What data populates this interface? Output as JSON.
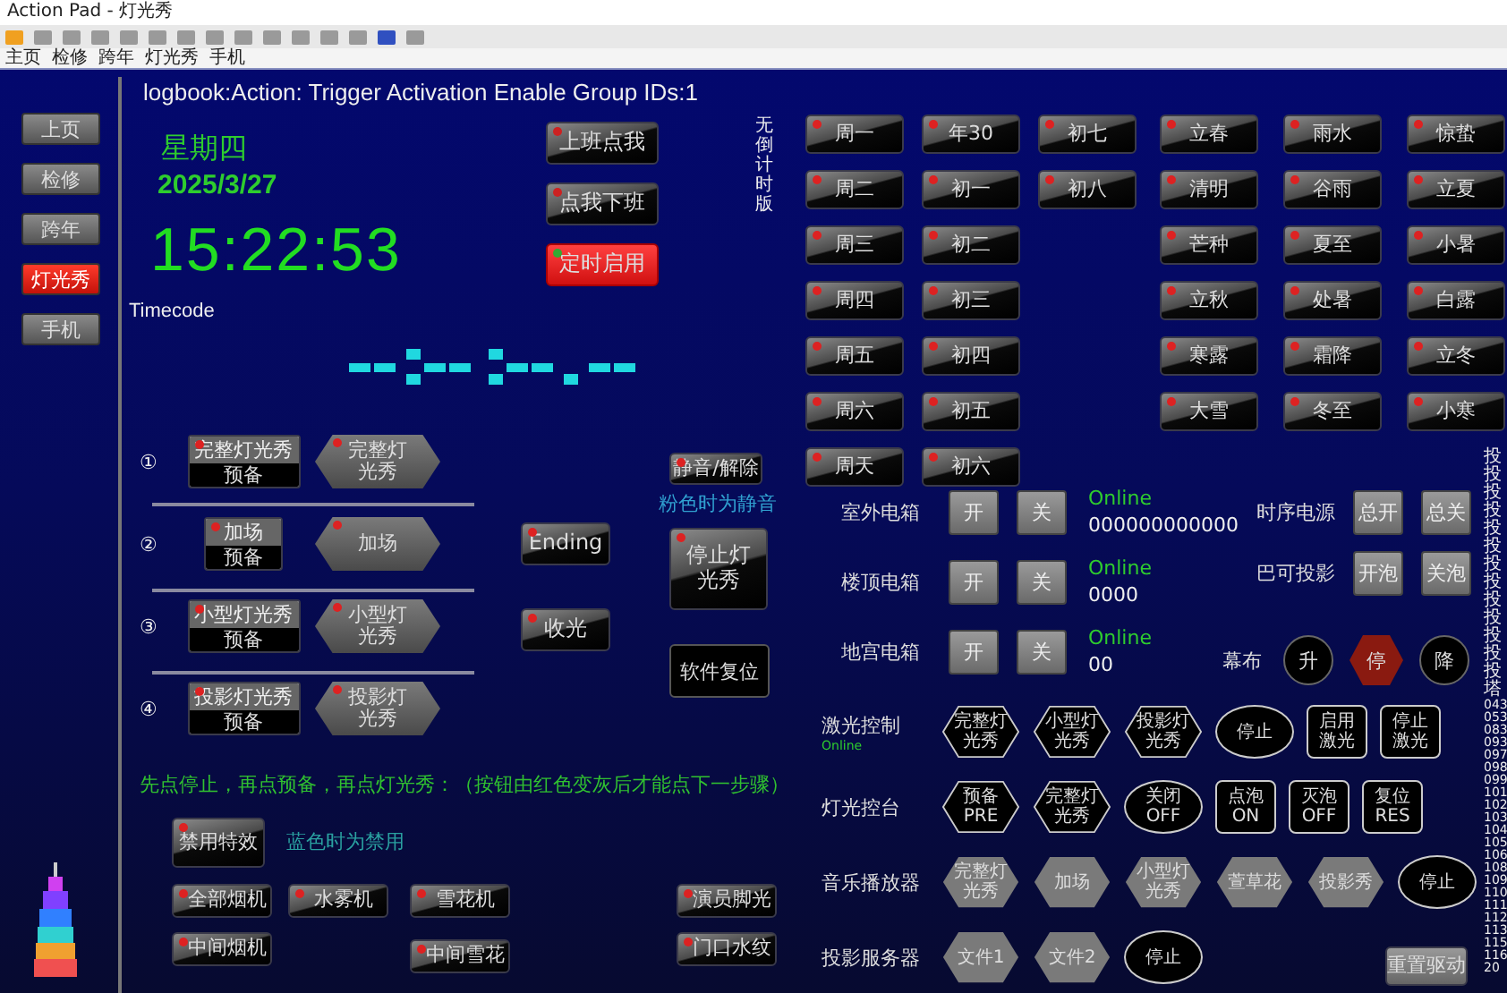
{
  "window": {
    "title": "Action Pad - 灯光秀"
  },
  "menu_tabs": [
    "主页",
    "检修",
    "跨年",
    "灯光秀",
    "手机"
  ],
  "sidebar": [
    {
      "label": "上页",
      "selected": false
    },
    {
      "label": "检修",
      "selected": false
    },
    {
      "label": "跨年",
      "selected": false
    },
    {
      "label": "灯光秀",
      "selected": true
    },
    {
      "label": "手机",
      "selected": false
    }
  ],
  "logbook": "logbook:Action: Trigger Activation Enable Group IDs:1",
  "weekday": "星期四",
  "date": "2025/3/27",
  "time": "15:22:53",
  "timecode_label": "Timecode",
  "top_buttons": [
    {
      "label": "上班点我",
      "color": "#cc2222",
      "active": false
    },
    {
      "label": "点我下班",
      "color": "#cc2222",
      "active": false
    },
    {
      "label": "定时启用",
      "color": "#33aa33",
      "active": true
    }
  ],
  "shows": [
    {
      "number": "①",
      "prep_top": "完整灯光秀",
      "prep_bottom": "预备",
      "play": "完整灯光秀"
    },
    {
      "number": "②",
      "prep_top": "加场",
      "prep_bottom": "预备",
      "play": "加场"
    },
    {
      "number": "③",
      "prep_top": "小型灯光秀",
      "prep_bottom": "预备",
      "play": "小型灯光秀"
    },
    {
      "number": "④",
      "prep_top": "投影灯光秀",
      "prep_bottom": "预备",
      "play": "投影灯光秀"
    }
  ],
  "ending_buttons": [
    "Ending",
    "收光"
  ],
  "mute_button": "静音/解除",
  "mute_hint": "粉色时为静音",
  "stop_show_button": "停止灯光秀",
  "reset_button": "软件复位",
  "instruction": "先点停止，再点预备，再点灯光秀：（按钮由红色变灰后才能点下一步骤）",
  "disable_fx_button": "禁用特效",
  "disable_fx_hint": "蓝色时为禁用",
  "effects": [
    [
      "全部烟机",
      "中间烟机"
    ],
    [
      "水雾机"
    ],
    [
      "雪花机",
      "中间雪花"
    ],
    [
      "演员脚光",
      "门口水纹"
    ]
  ],
  "countdown_note": "无倒计时版",
  "day_columns": [
    [
      "周一",
      "周二",
      "周三",
      "周四",
      "周五",
      "周六",
      "周天"
    ],
    [
      "年30",
      "初一",
      "初二",
      "初三",
      "初四",
      "初五",
      "初六"
    ],
    [
      "初七",
      "初八"
    ]
  ],
  "solar_term_rows": [
    [
      "立春",
      "雨水",
      "惊蛰"
    ],
    [
      "清明",
      "谷雨",
      "立夏"
    ],
    [
      "芒种",
      "夏至",
      "小暑"
    ],
    [
      "立秋",
      "处暑",
      "白露"
    ],
    [
      "寒露",
      "霜降",
      "立冬"
    ],
    [
      "大雪",
      "冬至",
      "小寒"
    ]
  ],
  "power_boxes": [
    {
      "label": "室外电箱",
      "on": "开",
      "off": "关",
      "status": "Online",
      "value": "000000000000"
    },
    {
      "label": "楼顶电箱",
      "on": "开",
      "off": "关",
      "status": "Online",
      "value": "0000"
    },
    {
      "label": "地宫电箱",
      "on": "开",
      "off": "关",
      "status": "Online",
      "value": "00"
    }
  ],
  "power_controls": [
    {
      "label": "时序电源",
      "buttons": [
        "总开",
        "总关"
      ]
    },
    {
      "label": "巴可投影",
      "buttons": [
        "开泡",
        "关泡"
      ]
    }
  ],
  "curtain": {
    "label": "幕布",
    "buttons": [
      {
        "label": "升",
        "kind": "circle",
        "active": false
      },
      {
        "label": "停",
        "kind": "hex",
        "active": true
      },
      {
        "label": "降",
        "kind": "circle",
        "active": false
      }
    ]
  },
  "control_rows": [
    {
      "label": "激光控制",
      "status": "Online",
      "buttons": [
        {
          "label": "完整灯光秀",
          "kind": "hex-outline"
        },
        {
          "label": "小型灯光秀",
          "kind": "hex-outline"
        },
        {
          "label": "投影灯光秀",
          "kind": "hex-outline"
        },
        {
          "label": "停止",
          "kind": "ellipse"
        },
        {
          "label": "启用激光",
          "kind": "rect"
        },
        {
          "label": "停止激光",
          "kind": "rect"
        }
      ]
    },
    {
      "label": "灯光控台",
      "buttons": [
        {
          "label": "预备\nPRE",
          "kind": "hex-outline"
        },
        {
          "label": "完整灯光秀",
          "kind": "hex-outline"
        },
        {
          "label": "关闭\nOFF",
          "kind": "ellipse"
        },
        {
          "label": "点泡\nON",
          "kind": "rect"
        },
        {
          "label": "灭泡\nOFF",
          "kind": "rect"
        },
        {
          "label": "复位\nRES",
          "kind": "rect"
        }
      ]
    },
    {
      "label": "音乐播放器",
      "buttons": [
        {
          "label": "完整灯光秀",
          "kind": "hex-filled"
        },
        {
          "label": "加场",
          "kind": "hex-filled"
        },
        {
          "label": "小型灯光秀",
          "kind": "hex-filled"
        },
        {
          "label": "萱草花",
          "kind": "hex-filled"
        },
        {
          "label": "投影秀",
          "kind": "hex-filled"
        },
        {
          "label": "停止",
          "kind": "ellipse"
        }
      ]
    },
    {
      "label": "投影服务器",
      "buttons": [
        {
          "label": "文件1",
          "kind": "hex-filled"
        },
        {
          "label": "文件2",
          "kind": "hex-filled"
        },
        {
          "label": "停止",
          "kind": "ellipse"
        }
      ]
    }
  ],
  "reset_driver_button": "重置驱动",
  "log_lines": [
    "投",
    "投",
    "投",
    "投",
    "投",
    "投",
    "投",
    "投",
    "投",
    "投",
    "投",
    "投",
    "投",
    "塔",
    "043",
    "053",
    "083",
    "093",
    "097",
    "098",
    "099",
    "101",
    "102",
    "103",
    "104",
    "105",
    "106",
    "108",
    "109",
    "110",
    "111",
    "112",
    "113",
    "115",
    "116",
    "20"
  ]
}
